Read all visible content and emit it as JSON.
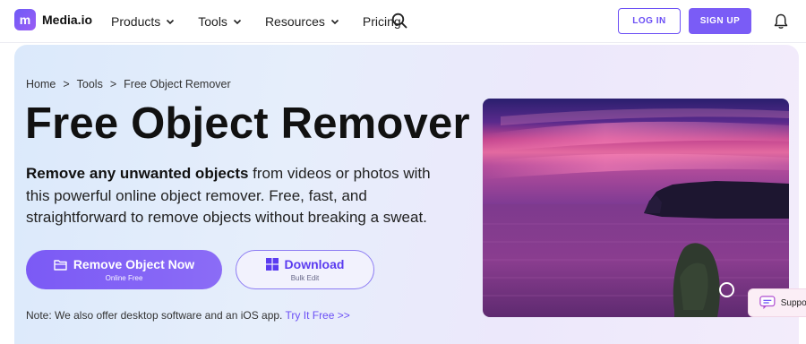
{
  "brand": {
    "logo_letter": "m",
    "name": "Media.io"
  },
  "nav": {
    "items": [
      {
        "label": "Products",
        "has_dropdown": true
      },
      {
        "label": "Tools",
        "has_dropdown": true
      },
      {
        "label": "Resources",
        "has_dropdown": true
      },
      {
        "label": "Pricing",
        "has_dropdown": false
      }
    ],
    "search_icon": "search-icon",
    "login_label": "LOG IN",
    "signup_label": "SIGN UP",
    "bell_icon": "bell-icon"
  },
  "breadcrumb": [
    "Home",
    ">",
    "Tools",
    ">",
    "Free Object Remover"
  ],
  "hero": {
    "title": "Free Object Remover",
    "desc_bold": "Remove any unwanted objects",
    "desc_rest": " from videos or photos with this powerful online object remover. Free, fast, and straightforward to remove objects without breaking a sweat.",
    "primary_button": {
      "label": "Remove Object Now",
      "sublabel": "Online Free",
      "icon": "folder-icon"
    },
    "secondary_button": {
      "label": "Download",
      "sublabel": "Bulk Edit",
      "icon": "windows-icon"
    },
    "note_text": "Note: We also offer desktop software and an iOS app. ",
    "note_link": "Try It Free >>"
  },
  "support": {
    "label": "Suppor"
  },
  "colors": {
    "accent": "#7a5cf6",
    "accent_dark": "#6b4ff5"
  }
}
